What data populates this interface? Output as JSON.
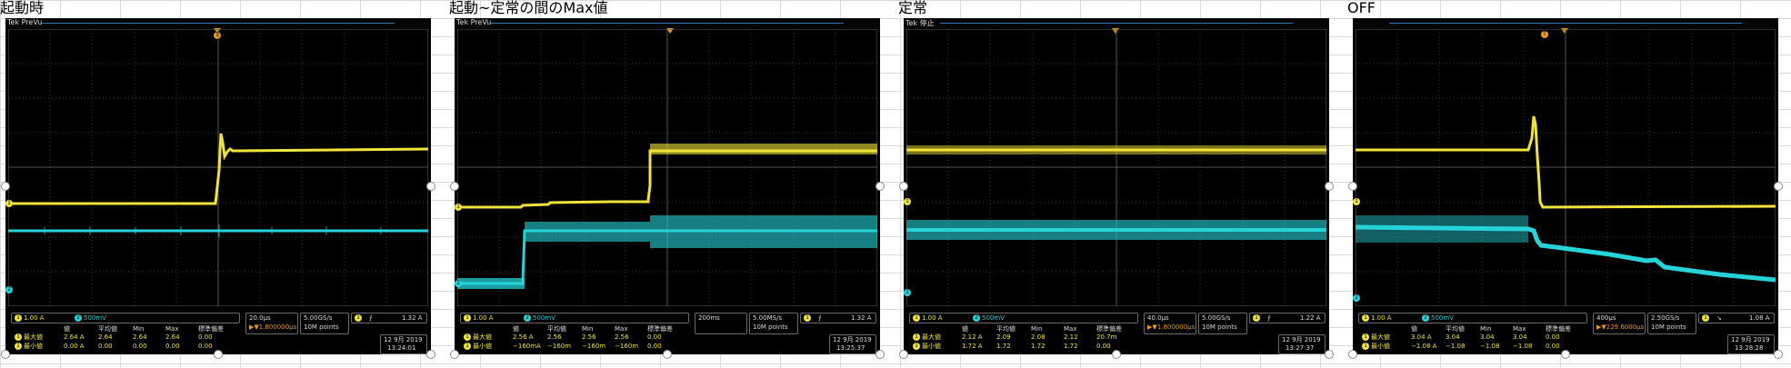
{
  "panels": [
    {
      "title": "起動時",
      "tek_label": "Tek PreVu",
      "trigger_marker": "T",
      "ch1_label": "1",
      "ch2_label": "2",
      "ch1_scale": "1.00 A",
      "ch2_scale": "500mV",
      "timebase": "20.0µs",
      "position": "▶▼1.800000µs",
      "sample_rate": "5.00GS/s",
      "record_length": "10M points",
      "trigger_level": "1.32 A",
      "meas_headers": [
        "値",
        "平均値",
        "Min",
        "Max",
        "標準偏差"
      ],
      "meas_rows": [
        {
          "name": "最大値",
          "values": [
            "2.64 A",
            "2.64",
            "2.64",
            "2.64",
            "0.00"
          ]
        },
        {
          "name": "最小値",
          "values": [
            "0.00 A",
            "0.00",
            "0.00",
            "0.00",
            "0.00"
          ]
        }
      ],
      "date": "12 9月  2019",
      "time": "13:24:01"
    },
    {
      "title": "起動~定常の間のMax値",
      "tek_label": "Tek PreVu",
      "trigger_marker": "T",
      "ch1_label": "1",
      "ch2_label": "2",
      "ch1_scale": "1.00 A",
      "ch2_scale": "500mV",
      "timebase": "200ms",
      "position": "",
      "sample_rate": "5.00MS/s",
      "record_length": "10M points",
      "trigger_level": "1.32 A",
      "meas_headers": [
        "値",
        "平均値",
        "Min",
        "Max",
        "標準偏差"
      ],
      "meas_rows": [
        {
          "name": "最大値",
          "values": [
            "2.56 A",
            "2.56",
            "2.56",
            "2.56",
            "0.00"
          ]
        },
        {
          "name": "最小値",
          "values": [
            "−160mA",
            "−160m",
            "−160m",
            "−160m",
            "0.00"
          ]
        }
      ],
      "date": "12 9月  2019",
      "time": "13:25:37"
    },
    {
      "title": "定常",
      "tek_label": "Tek 停止",
      "trigger_marker": "T",
      "ch1_label": "1",
      "ch2_label": "2",
      "ch1_scale": "1.00 A",
      "ch2_scale": "500mV",
      "timebase": "40.0µs",
      "position": "▶▼1.800000µs",
      "sample_rate": "5.00GS/s",
      "record_length": "10M points",
      "trigger_level": "1.22 A",
      "meas_headers": [
        "値",
        "平均値",
        "Min",
        "Max",
        "標準偏差"
      ],
      "meas_rows": [
        {
          "name": "最大値",
          "values": [
            "2.12 A",
            "2.09",
            "2.08",
            "2.12",
            "20.7m"
          ]
        },
        {
          "name": "最小値",
          "values": [
            "1.72 A",
            "1.72",
            "1.72",
            "1.72",
            "0.00"
          ]
        }
      ],
      "date": "12 9月  2019",
      "time": "13:27:37"
    },
    {
      "title": "OFF",
      "tek_label": "",
      "trigger_marker": "T",
      "ch1_label": "1",
      "ch2_label": "2",
      "ch1_scale": "1.00 A",
      "ch2_scale": "500mV",
      "timebase": "400µs",
      "position": "▶▼229.6000µs",
      "sample_rate": "2.50GS/s",
      "record_length": "10M points",
      "trigger_level": "1.08 A",
      "meas_headers": [
        "値",
        "平均値",
        "Min",
        "Max",
        "標準偏差"
      ],
      "meas_rows": [
        {
          "name": "最大値",
          "values": [
            "3.04 A",
            "3.04",
            "3.04",
            "3.04",
            "0.00"
          ]
        },
        {
          "name": "最小値",
          "values": [
            "−1.08 A",
            "−1.08",
            "−1.08",
            "−1.08",
            "0.00"
          ]
        }
      ],
      "date": "12 9月  2019",
      "time": "13:28:28"
    }
  ],
  "colors": {
    "ch1": "#f0e43a",
    "ch2": "#26d3d9",
    "trigger": "#e79a20",
    "grid": "#3a3a3a",
    "background": "#000000"
  },
  "icons": {
    "ch1_badge": "yellow-circle-1",
    "ch2_badge": "cyan-circle-2",
    "trigger_slope": "rising-edge-icon",
    "trigger_slope_falling": "falling-edge-icon"
  }
}
